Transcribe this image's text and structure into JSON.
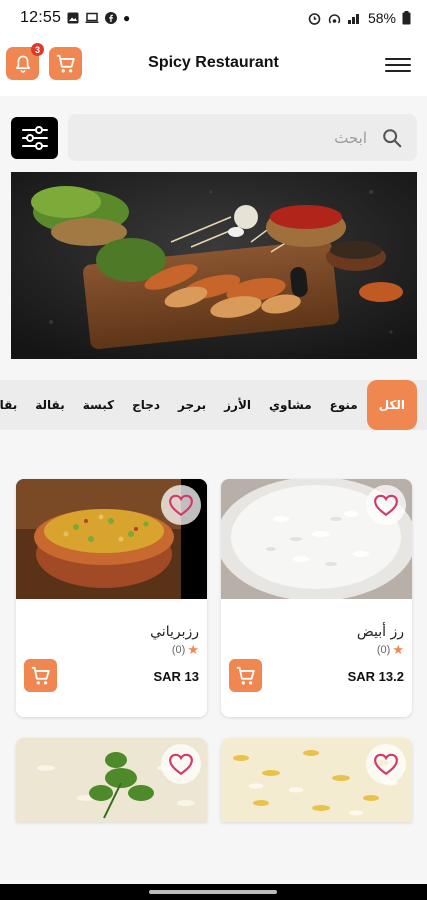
{
  "status_bar": {
    "time": "12:55",
    "battery": "58%",
    "icons": [
      "gallery-icon",
      "laptop-icon",
      "facebook-icon",
      "dot-icon",
      "alarm-icon",
      "hotspot-icon",
      "signal-icon",
      "battery-icon"
    ]
  },
  "header": {
    "title": "Spicy Restaurant",
    "notification_count": "3",
    "icons": [
      "bell-icon",
      "cart-icon",
      "hamburger-menu-icon"
    ],
    "accent_color": "#f08650"
  },
  "search": {
    "placeholder": "ابحث",
    "value": ""
  },
  "categories": {
    "items": [
      {
        "label": "الكل",
        "active": true
      },
      {
        "label": "منوع",
        "active": false
      },
      {
        "label": "مشاوي",
        "active": false
      },
      {
        "label": "الأرز",
        "active": false
      },
      {
        "label": "برجر",
        "active": false
      },
      {
        "label": "دجاج",
        "active": false
      },
      {
        "label": "كبسة",
        "active": false
      },
      {
        "label": "بقالة",
        "active": false
      },
      {
        "label": "بقالة",
        "active": false
      }
    ]
  },
  "products": [
    {
      "name": "رز أبيض",
      "rating": "(0)",
      "price": "SAR 13.2"
    },
    {
      "name": "رزبرياني",
      "rating": "(0)",
      "price": "SAR 13"
    },
    {
      "name": "",
      "rating": "",
      "price": ""
    },
    {
      "name": "",
      "rating": "",
      "price": ""
    }
  ]
}
